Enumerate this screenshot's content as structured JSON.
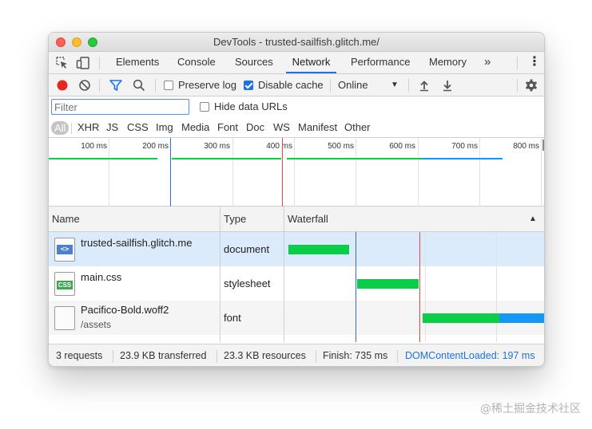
{
  "window": {
    "title": "DevTools - trusted-sailfish.glitch.me/"
  },
  "tabs": {
    "elements": "Elements",
    "console": "Console",
    "sources": "Sources",
    "network": "Network",
    "performance": "Performance",
    "memory": "Memory",
    "more": "»",
    "kebab": "⋮"
  },
  "toolbar": {
    "preserve_log": "Preserve log",
    "disable_cache": "Disable cache",
    "throttle": "Online",
    "throttle_caret": "▼"
  },
  "filter": {
    "placeholder": "Filter",
    "hide_data_urls": "Hide data URLs"
  },
  "types": [
    "All",
    "XHR",
    "JS",
    "CSS",
    "Img",
    "Media",
    "Font",
    "Doc",
    "WS",
    "Manifest",
    "Other"
  ],
  "overview": {
    "ticks": [
      "100 ms",
      "200 ms",
      "300 ms",
      "400 ms",
      "500 ms",
      "600 ms",
      "700 ms",
      "800 ms"
    ]
  },
  "table": {
    "col_name": "Name",
    "col_type": "Type",
    "col_waterfall": "Waterfall",
    "sort_icon": "▲"
  },
  "rows": [
    {
      "name": "trusted-sailfish.glitch.me",
      "sub": "",
      "type": "document",
      "icon": "<>"
    },
    {
      "name": "main.css",
      "sub": "",
      "type": "stylesheet",
      "icon": "CSS"
    },
    {
      "name": "Pacifico-Bold.woff2",
      "sub": "/assets",
      "type": "font",
      "icon": ""
    }
  ],
  "status": {
    "requests": "3 requests",
    "transferred": "23.9 KB transferred",
    "resources": "23.3 KB resources",
    "finish": "Finish: 735 ms",
    "domcontentloaded": "DOMContentLoaded: 197 ms"
  },
  "watermark": "@稀土掘金技术社区",
  "colors": {
    "accent": "#1a73e8",
    "bar_green": "#0bce48",
    "bar_blue": "#1597f5",
    "dcl_line": "#2f6fd6",
    "load_line": "#e04848",
    "record_red": "#e8261f"
  }
}
